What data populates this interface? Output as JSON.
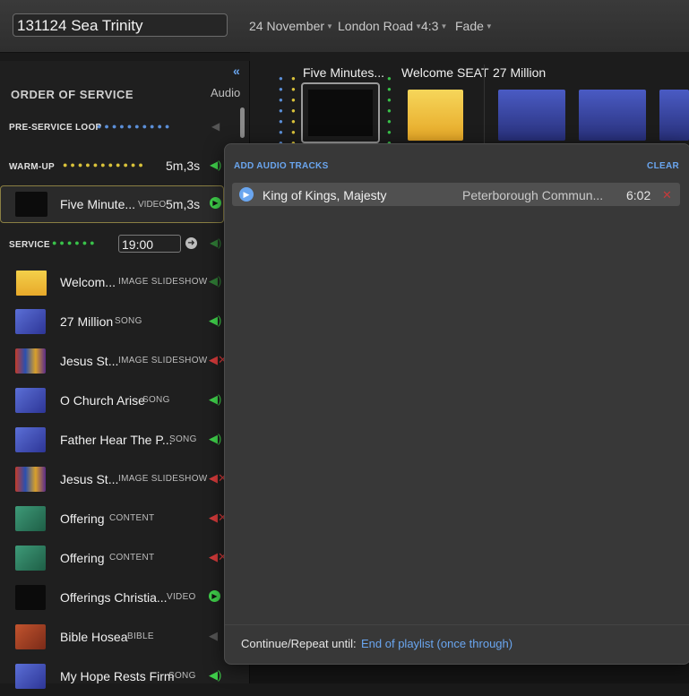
{
  "header": {
    "title": "131124 Sea Trinity",
    "dropdowns": [
      "24 November",
      "London Road",
      "4:3",
      "Fade"
    ]
  },
  "sidebar": {
    "collapse_glyph": "«",
    "section_title": "ORDER OF SERVICE",
    "audio_label": "Audio",
    "pre_service": {
      "label": "PRE-SERVICE LOOP"
    },
    "warm_up": {
      "label": "WARM-UP",
      "duration": "5m,3s"
    },
    "selected_item": {
      "name": "Five Minute...",
      "kind": "VIDEO",
      "duration": "5m,3s"
    },
    "service": {
      "label": "SERVICE",
      "start_time": "19:00"
    },
    "items": [
      {
        "name": "Welcom...",
        "kind": "IMAGE SLIDESHOW",
        "audio": "on-dim"
      },
      {
        "name": "27 Million",
        "kind": "SONG",
        "audio": "on"
      },
      {
        "name": "Jesus St...",
        "kind": "IMAGE SLIDESHOW",
        "audio": "muted"
      },
      {
        "name": "O Church Arise",
        "kind": "SONG",
        "audio": "on"
      },
      {
        "name": "Father Hear The P...",
        "kind": "SONG",
        "audio": "on"
      },
      {
        "name": "Jesus St...",
        "kind": "IMAGE SLIDESHOW",
        "audio": "muted"
      },
      {
        "name": "Offering",
        "kind": "CONTENT",
        "audio": "muted"
      },
      {
        "name": "Offering",
        "kind": "CONTENT",
        "audio": "muted"
      },
      {
        "name": "Offerings Christia...",
        "kind": "VIDEO",
        "audio": "play"
      },
      {
        "name": "Bible Hosea",
        "kind": "BIBLE",
        "audio": "off"
      },
      {
        "name": "My Hope Rests Firm",
        "kind": "SONG",
        "audio": "on"
      }
    ]
  },
  "main": {
    "slides": [
      {
        "title": "Five Minutes..."
      },
      {
        "title": "Welcome SEAT"
      },
      {
        "title": "27 Million"
      }
    ]
  },
  "popup": {
    "title": "ADD AUDIO TRACKS",
    "clear_label": "CLEAR",
    "track": {
      "name": "King of Kings, Majesty",
      "artist": "Peterborough Commun...",
      "duration": "6:02"
    },
    "repeat_label": "Continue/Repeat until:",
    "repeat_value": "End of playlist (once through)"
  },
  "colors": {
    "accent": "#6aa6f0",
    "dot_blue": "#5b8fd8",
    "dot_yellow": "#d9c23a",
    "dot_green": "#39c24a",
    "audio_on": "#3fcf4a",
    "audio_muted": "#d23a3a"
  }
}
